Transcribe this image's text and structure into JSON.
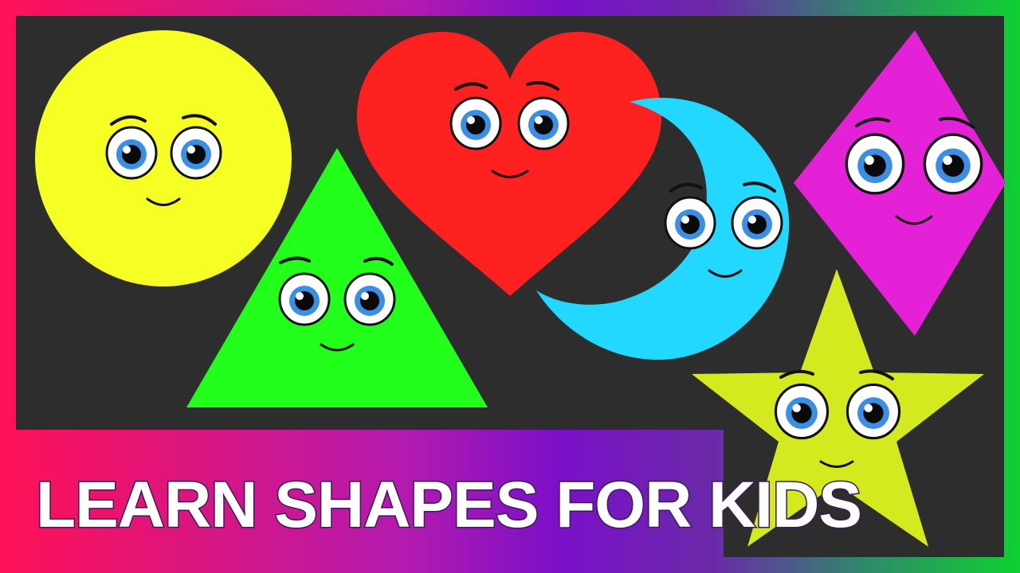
{
  "title": "LEARN SHAPES FOR KIDS",
  "colors": {
    "panel": "#2d2d2d",
    "circle": "#f6ff24",
    "triangle": "#22ff1a",
    "heart": "#ff2020",
    "moon": "#22d8ff",
    "diamond": "#e421d6",
    "star": "#d2ea1e",
    "iris": "#3b8ee6",
    "frame_left": "#ff1155",
    "frame_right": "#10d030"
  },
  "shapes": [
    "circle",
    "triangle",
    "heart",
    "moon",
    "diamond",
    "star"
  ]
}
